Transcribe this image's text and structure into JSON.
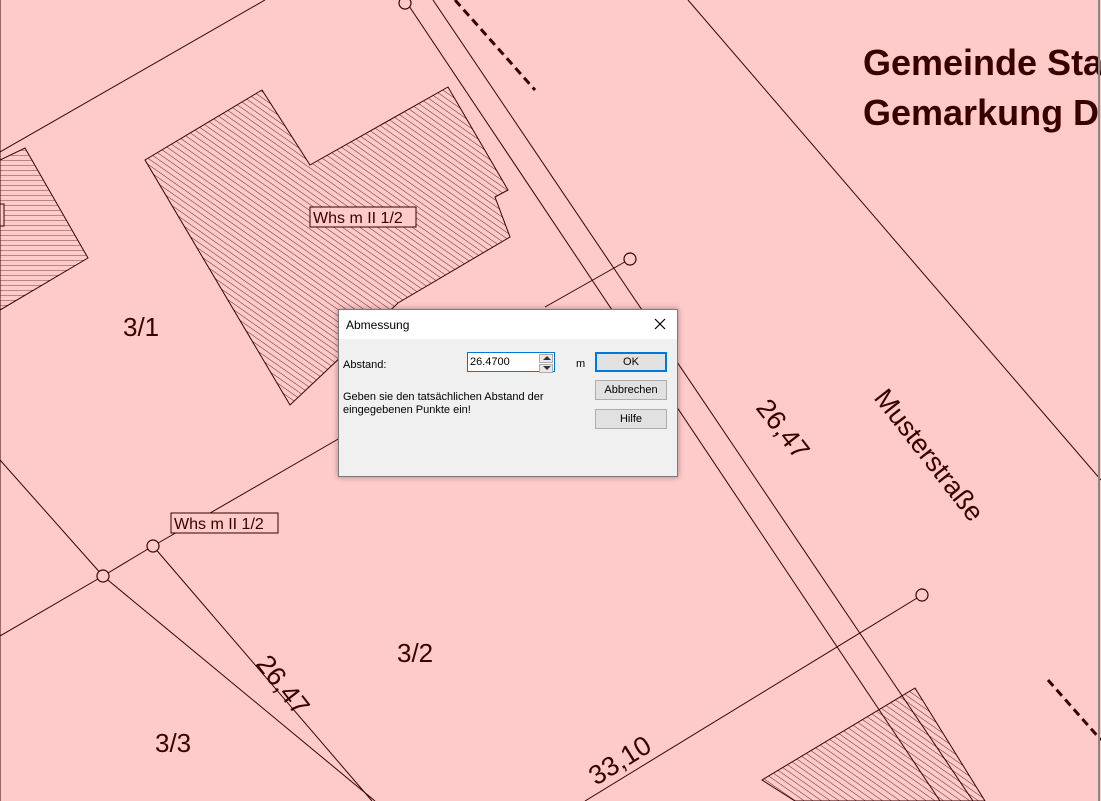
{
  "map": {
    "heading_line1": "Gemeinde Sta",
    "heading_line2": "Gemarkung D",
    "street_name": "Musterstraße",
    "parcels": [
      "3/1",
      "3/2",
      "3/3"
    ],
    "dimensions": [
      "26,47",
      "26,47",
      "33,10"
    ],
    "building_labels": [
      "Whs m  II 1/2",
      "Whs m  II 1/2"
    ],
    "colors": {
      "background": "#ffcaca",
      "ink": "#3a0000"
    }
  },
  "dialog": {
    "title": "Abmessung",
    "distance_label": "Abstand:",
    "distance_value": "26.4700",
    "unit": "m",
    "hint": [
      "Geben sie den tatsächlichen Abstand der",
      "eingegebenen Punkte ein!"
    ],
    "ok": "OK",
    "cancel": "Abbrechen",
    "help": "Hilfe"
  }
}
